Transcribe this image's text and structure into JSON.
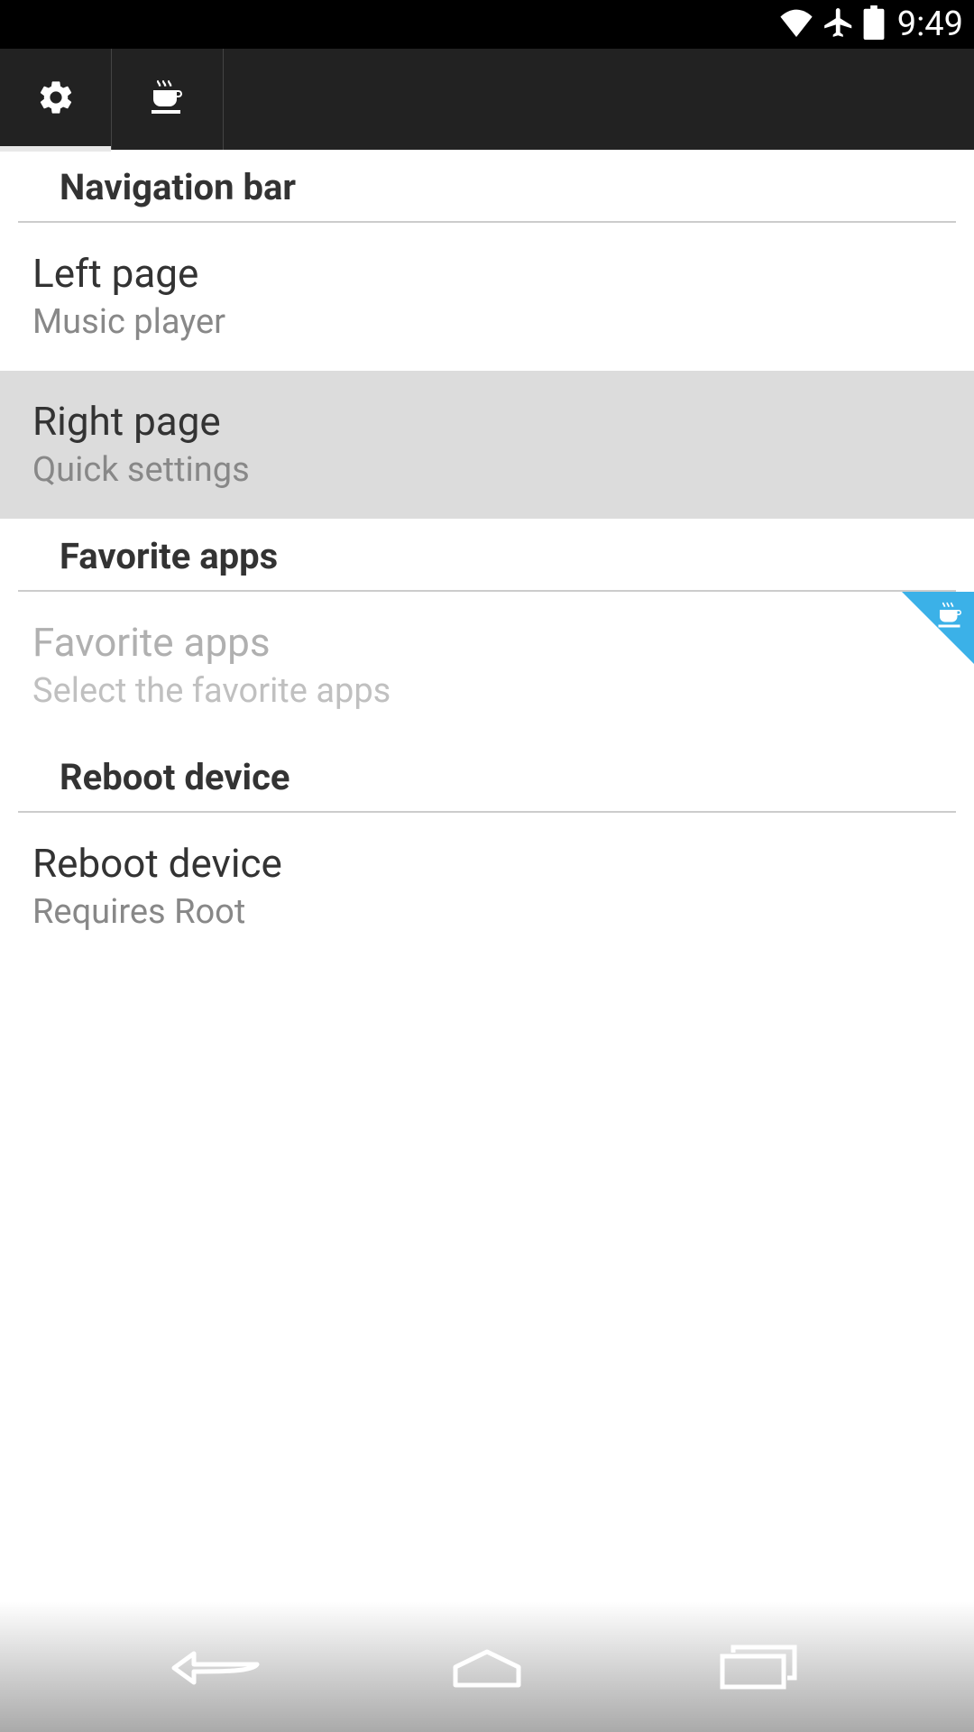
{
  "status": {
    "time": "9:49"
  },
  "sections": {
    "navigation": {
      "header": "Navigation bar",
      "left_page": {
        "title": "Left page",
        "subtitle": "Music player"
      },
      "right_page": {
        "title": "Right page",
        "subtitle": "Quick settings"
      }
    },
    "favorites": {
      "header": "Favorite apps",
      "item": {
        "title": "Favorite apps",
        "subtitle": "Select the favorite apps"
      }
    },
    "reboot": {
      "header": "Reboot device",
      "item": {
        "title": "Reboot device",
        "subtitle": "Requires Root"
      }
    }
  }
}
